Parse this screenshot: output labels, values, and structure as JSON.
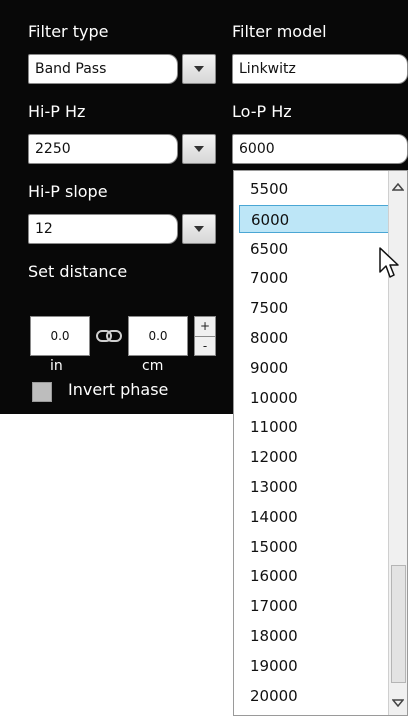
{
  "filter_type": {
    "label": "Filter type",
    "value": "Band Pass"
  },
  "filter_model": {
    "label": "Filter model",
    "value": "Linkwitz"
  },
  "hip": {
    "label": "Hi-P Hz",
    "value": "2250"
  },
  "lop": {
    "label": "Lo-P Hz",
    "value": "6000"
  },
  "hip_slope": {
    "label": "Hi-P slope",
    "value": "12"
  },
  "distance": {
    "label": "Set distance",
    "in_value": "0.0",
    "cm_value": "0.0",
    "in_unit": "in",
    "cm_unit": "cm",
    "plus": "+",
    "minus": "-"
  },
  "invert": {
    "label": "Invert phase",
    "checked": false
  },
  "dropdown": {
    "selected": "6000",
    "options": [
      "5500",
      "6000",
      "6500",
      "7000",
      "7500",
      "8000",
      "9000",
      "10000",
      "11000",
      "12000",
      "13000",
      "14000",
      "15000",
      "16000",
      "17000",
      "18000",
      "19000",
      "20000"
    ]
  },
  "icons": {
    "link": "link-icon",
    "cursor": "pointer-cursor-icon"
  }
}
